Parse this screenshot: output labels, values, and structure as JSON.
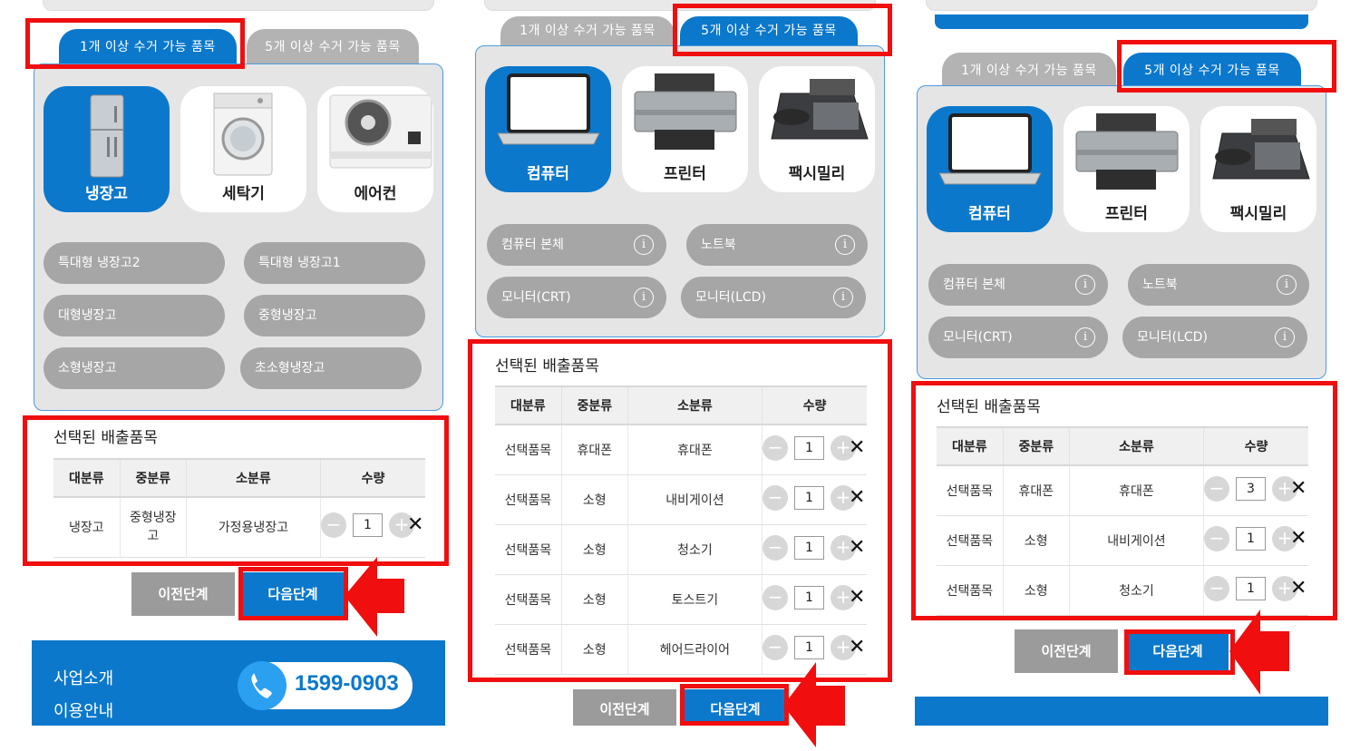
{
  "panels": [
    {
      "tabs": [
        "1개 이상 수거 가능 품목",
        "5개 이상 수거 가능 품목"
      ],
      "active_tab": 0,
      "categories": [
        {
          "label": "냉장고",
          "icon": "refrigerator-icon",
          "selected": true
        },
        {
          "label": "세탁기",
          "icon": "washing-machine-icon",
          "selected": false
        },
        {
          "label": "에어컨",
          "icon": "air-conditioner-icon",
          "selected": false
        }
      ],
      "items": [
        "특대형 냉장고2",
        "특대형 냉장고1",
        "대형냉장고",
        "중형냉장고",
        "소형냉장고",
        "초소형냉장고"
      ],
      "selected_title": "선택된 배출품목",
      "headers": [
        "대분류",
        "중분류",
        "소분류",
        "수량"
      ],
      "rows": [
        {
          "major": "냉장고",
          "middle": "중형냉장고",
          "minor": "가정용냉장고",
          "qty": "1"
        }
      ],
      "prev": "이전단계",
      "next": "다음단계",
      "footer": {
        "menu1": "사업소개",
        "menu2": "이용안내",
        "phone": "1599-0903"
      }
    },
    {
      "tabs": [
        "1개 이상 수거 가능 품목",
        "5개 이상 수거 가능 품목"
      ],
      "active_tab": 1,
      "categories": [
        {
          "label": "컴퓨터",
          "icon": "laptop-icon",
          "selected": true
        },
        {
          "label": "프린터",
          "icon": "printer-icon",
          "selected": false
        },
        {
          "label": "팩시밀리",
          "icon": "fax-machine-icon",
          "selected": false
        }
      ],
      "items": [
        "컴퓨터 본체",
        "노트북",
        "모니터(CRT)",
        "모니터(LCD)"
      ],
      "selected_title": "선택된 배출품목",
      "headers": [
        "대분류",
        "중분류",
        "소분류",
        "수량"
      ],
      "rows": [
        {
          "major": "선택품목",
          "middle": "휴대폰",
          "minor": "휴대폰",
          "qty": "1"
        },
        {
          "major": "선택품목",
          "middle": "소형",
          "minor": "내비게이션",
          "qty": "1"
        },
        {
          "major": "선택품목",
          "middle": "소형",
          "minor": "청소기",
          "qty": "1"
        },
        {
          "major": "선택품목",
          "middle": "소형",
          "minor": "토스트기",
          "qty": "1"
        },
        {
          "major": "선택품목",
          "middle": "소형",
          "minor": "헤어드라이어",
          "qty": "1"
        }
      ],
      "prev": "이전단계",
      "next": "다음단계"
    },
    {
      "tabs": [
        "1개 이상 수거 가능 품목",
        "5개 이상 수거 가능 품목"
      ],
      "active_tab": 1,
      "categories": [
        {
          "label": "컴퓨터",
          "icon": "laptop-icon",
          "selected": true
        },
        {
          "label": "프린터",
          "icon": "printer-icon",
          "selected": false
        },
        {
          "label": "팩시밀리",
          "icon": "fax-machine-icon",
          "selected": false
        }
      ],
      "items": [
        "컴퓨터 본체",
        "노트북",
        "모니터(CRT)",
        "모니터(LCD)"
      ],
      "selected_title": "선택된 배출품목",
      "headers": [
        "대분류",
        "중분류",
        "소분류",
        "수량"
      ],
      "rows": [
        {
          "major": "선택품목",
          "middle": "휴대폰",
          "minor": "휴대폰",
          "qty": "3"
        },
        {
          "major": "선택품목",
          "middle": "소형",
          "minor": "내비게이션",
          "qty": "1"
        },
        {
          "major": "선택품목",
          "middle": "소형",
          "minor": "청소기",
          "qty": "1"
        }
      ],
      "prev": "이전단계",
      "next": "다음단계"
    }
  ],
  "colors": {
    "primary": "#0b78cc",
    "highlight": "#f00e0e",
    "pill": "#a6a6a6",
    "panel_bg": "#e5e5e5"
  },
  "icons": {
    "minus": "−",
    "plus": "+",
    "delete": "✕",
    "info": "i"
  }
}
